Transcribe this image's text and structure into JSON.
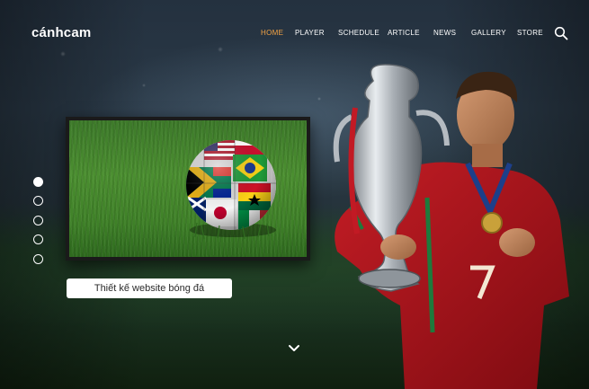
{
  "brand": {
    "logo_text": "cánhcam"
  },
  "nav": {
    "items": [
      {
        "label": "HOME",
        "active": true
      },
      {
        "label": "PLAYER",
        "active": false
      },
      {
        "label": "SCHEDULE",
        "active": false
      },
      {
        "label": "ARTICLE",
        "active": false
      },
      {
        "label": "NEWS",
        "active": false
      },
      {
        "label": "GALLERY",
        "active": false
      },
      {
        "label": "STORE",
        "active": false
      }
    ],
    "search_icon": "search-icon"
  },
  "slider": {
    "dot_count": 5,
    "active_index": 0
  },
  "hero": {
    "caption": "Thiết kế website bóng đá",
    "player_shirt_number": "7"
  },
  "colors": {
    "accent": "#f6a545",
    "text": "#ffffff",
    "jersey": "#b0141c"
  },
  "icons": {
    "scroll": "chevron-down-icon"
  }
}
